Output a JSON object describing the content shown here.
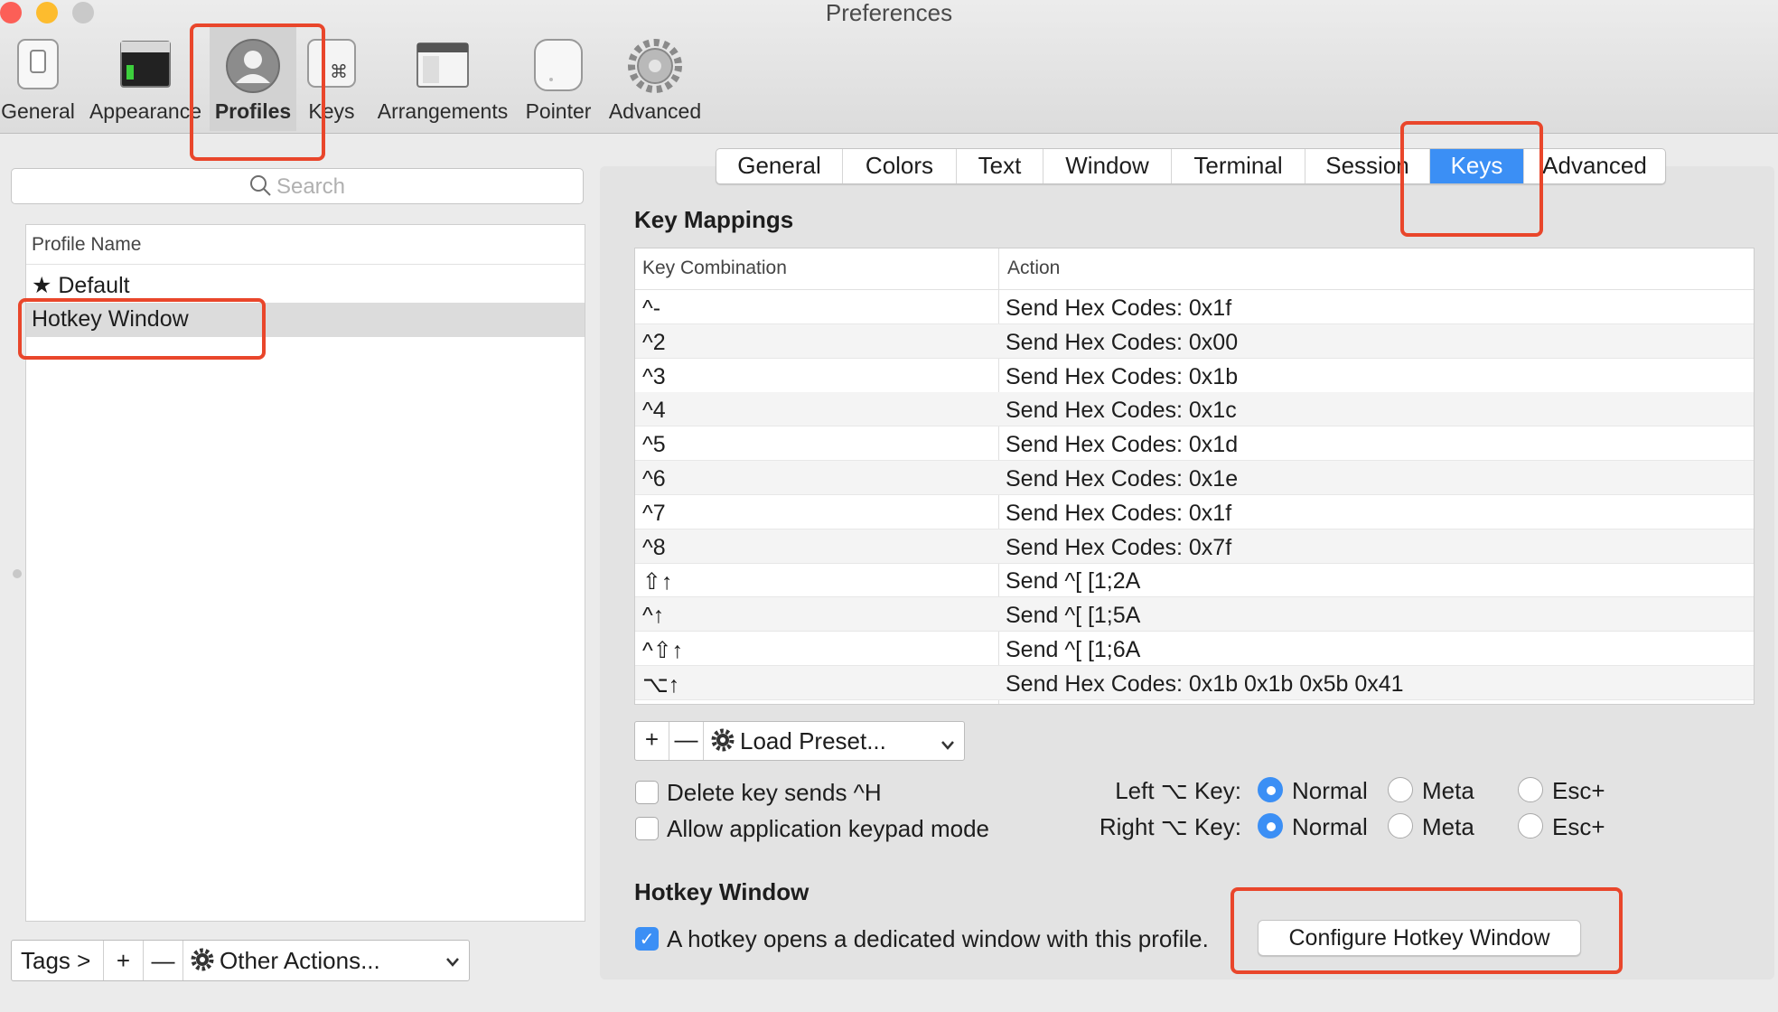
{
  "window": {
    "title": "Preferences"
  },
  "toolbar": {
    "items": [
      {
        "label": "General",
        "icon": "switch-icon"
      },
      {
        "label": "Appearance",
        "icon": "window-appearance-icon"
      },
      {
        "label": "Profiles",
        "icon": "user-silhouette-icon",
        "selected": true
      },
      {
        "label": "Keys",
        "icon": "command-key-icon"
      },
      {
        "label": "Arrangements",
        "icon": "windows-arrangement-icon"
      },
      {
        "label": "Pointer",
        "icon": "mouse-icon"
      },
      {
        "label": "Advanced",
        "icon": "gear-icon"
      }
    ]
  },
  "search": {
    "placeholder": "Search"
  },
  "profiles": {
    "header": "Profile Name",
    "items": [
      {
        "label": "★ Default"
      },
      {
        "label": "Hotkey Window",
        "selected": true
      }
    ]
  },
  "bottom_bar": {
    "tags": "Tags >",
    "add": "+",
    "remove": "—",
    "other_actions": "Other Actions..."
  },
  "tabs": [
    {
      "label": "General"
    },
    {
      "label": "Colors"
    },
    {
      "label": "Text"
    },
    {
      "label": "Window"
    },
    {
      "label": "Terminal"
    },
    {
      "label": "Session"
    },
    {
      "label": "Keys",
      "selected": true
    },
    {
      "label": "Advanced"
    }
  ],
  "key_mappings": {
    "title": "Key Mappings",
    "col_key": "Key Combination",
    "col_action": "Action",
    "rows": [
      {
        "key": "^-",
        "action": "Send Hex Codes: 0x1f"
      },
      {
        "key": "^2",
        "action": "Send Hex Codes: 0x00"
      },
      {
        "key": "^3",
        "action": "Send Hex Codes: 0x1b"
      },
      {
        "key": "^4",
        "action": "Send Hex Codes: 0x1c"
      },
      {
        "key": "^5",
        "action": "Send Hex Codes: 0x1d"
      },
      {
        "key": "^6",
        "action": "Send Hex Codes: 0x1e"
      },
      {
        "key": "^7",
        "action": "Send Hex Codes: 0x1f"
      },
      {
        "key": "^8",
        "action": "Send Hex Codes: 0x7f"
      },
      {
        "key": "⇧↑",
        "action": "Send ^[ [1;2A"
      },
      {
        "key": "^↑",
        "action": "Send ^[ [1;5A"
      },
      {
        "key": "^⇧↑",
        "action": "Send ^[ [1;6A"
      },
      {
        "key": "⌥↑",
        "action": "Send Hex Codes: 0x1b 0x1b 0x5b 0x41"
      }
    ],
    "add": "+",
    "remove": "—",
    "load_preset": "Load Preset..."
  },
  "options": {
    "delete_key": "Delete key sends ^H",
    "keypad_mode": "Allow application keypad mode",
    "left_option_label": "Left ⌥ Key:",
    "right_option_label": "Right ⌥ Key:",
    "choices": [
      "Normal",
      "Meta",
      "Esc+"
    ]
  },
  "hotkey": {
    "title": "Hotkey Window",
    "checkbox_label": "A hotkey opens a dedicated window with this profile.",
    "configure_button": "Configure Hotkey Window"
  },
  "colors": {
    "accent": "#3b8ff5",
    "highlight": "#e9462b"
  }
}
